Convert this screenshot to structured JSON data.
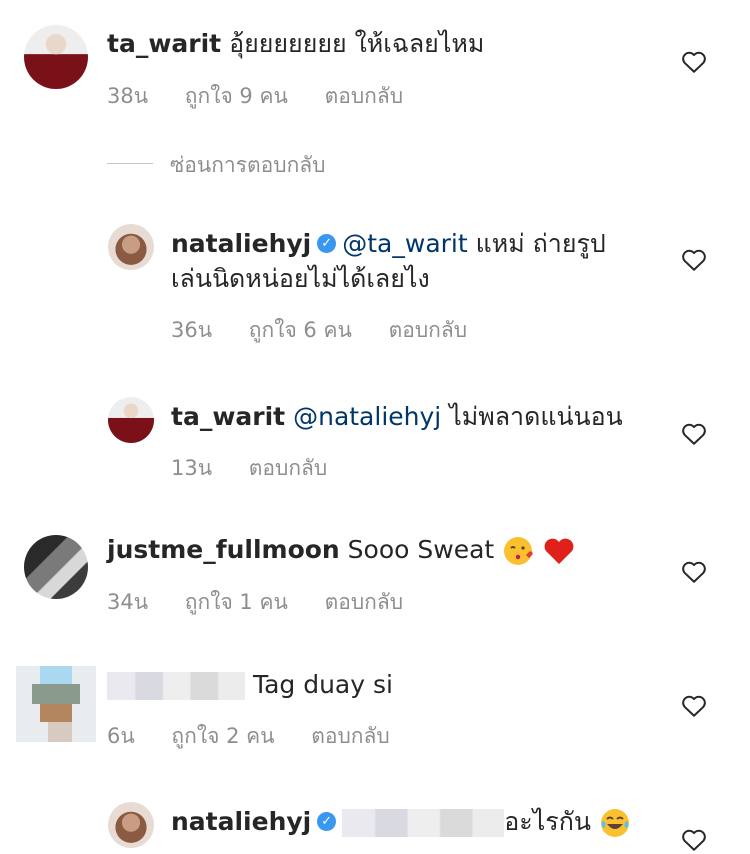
{
  "comments": [
    {
      "username": "ta_warit",
      "text": "อุ้ยยยยยยย ให้เฉลยไหม",
      "time": "38น",
      "likes": "ถูกใจ 9 คน",
      "reply": "ตอบกลับ"
    },
    {
      "hide_replies": "ซ่อนการตอบกลับ"
    },
    {
      "username": "nataliehyj",
      "mention": "@ta_warit",
      "text_line1": "แหม่ ถ่ายรูป",
      "text_line2": "เล่นนิดหน่อยไม่ได้เลยไง",
      "time": "36น",
      "likes": "ถูกใจ 6 คน",
      "reply": "ตอบกลับ"
    },
    {
      "username": "ta_warit",
      "mention": "@nataliehyj",
      "text": "ไม่พลาดแน่นอน",
      "time": "13น",
      "reply": "ตอบกลับ"
    },
    {
      "username": "justme_fullmoon",
      "text": "Sooo Sweat",
      "time": "34น",
      "likes": "ถูกใจ 1 คน",
      "reply": "ตอบกลับ"
    },
    {
      "text": "Tag duay si",
      "time": "6น",
      "likes": "ถูกใจ 2 คน",
      "reply": "ตอบกลับ"
    },
    {
      "username": "nataliehyj",
      "text": "อะไรกัน"
    }
  ],
  "icons": {
    "like": "heart-outline-icon",
    "verified": "verified-badge-icon"
  },
  "colors": {
    "mention": "#00376b",
    "meta": "#8e8e8e",
    "verified": "#3897f0"
  }
}
